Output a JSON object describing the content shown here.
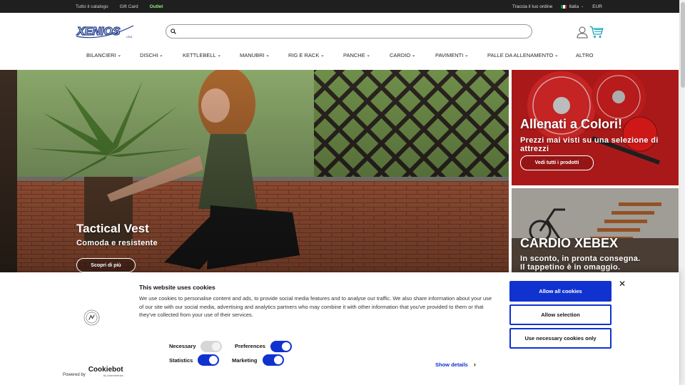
{
  "topbar": {
    "links": [
      "Tutto il catalogo",
      "Gift Card",
      "Outlet"
    ],
    "track_order": "Traccia il tuo ordine",
    "country": "Italia",
    "currency": "EUR"
  },
  "header": {
    "logo_text": "XENIOS",
    "logo_sub": "USA",
    "search_placeholder": ""
  },
  "nav": {
    "items": [
      "BILANCIERI",
      "DISCHI",
      "KETTLEBELL",
      "MANUBRI",
      "RIG E RACK",
      "PANCHE",
      "CARDIO",
      "PAVIMENTI",
      "PALLE DA ALLENAMENTO",
      "ALTRO"
    ]
  },
  "hero": {
    "title": "Tactical Vest",
    "subtitle": "Comoda e resistente",
    "button": "Scopri di più"
  },
  "promo1": {
    "title": "Allenati a Colori!",
    "subtitle_line1": "Prezzi mai visti su una selezione di",
    "subtitle_line2": "attrezzi",
    "button": "Vedi tutti i prodotti"
  },
  "promo2": {
    "title": "CARDIO XEBEX",
    "subtitle_line1": "In sconto, in pronta consegna.",
    "subtitle_line2": "Il tappetino è in omaggio."
  },
  "cookie": {
    "title": "This website uses cookies",
    "text": "We use cookies to personalise content and ads, to provide social media features and to analyse our traffic. We also share information about your use of our site with our social media, advertising and analytics partners who may combine it with other information that you've provided to them or that they've collected from your use of their services.",
    "powered_by": "Powered by",
    "brand": "Cookiebot",
    "brand_sub": "by Usercentrics",
    "toggles": {
      "necessary": "Necessary",
      "preferences": "Preferences",
      "statistics": "Statistics",
      "marketing": "Marketing"
    },
    "show_details": "Show details",
    "buttons": {
      "allow_all": "Allow all cookies",
      "allow_selection": "Allow selection",
      "necessary_only": "Use necessary cookies only"
    }
  },
  "colors": {
    "accent": "#1032cf",
    "topbar": "#1f1f1f",
    "outlet": "#8ef07a",
    "logo": "#1e3a8a",
    "promo_red": "#b91c1c"
  }
}
